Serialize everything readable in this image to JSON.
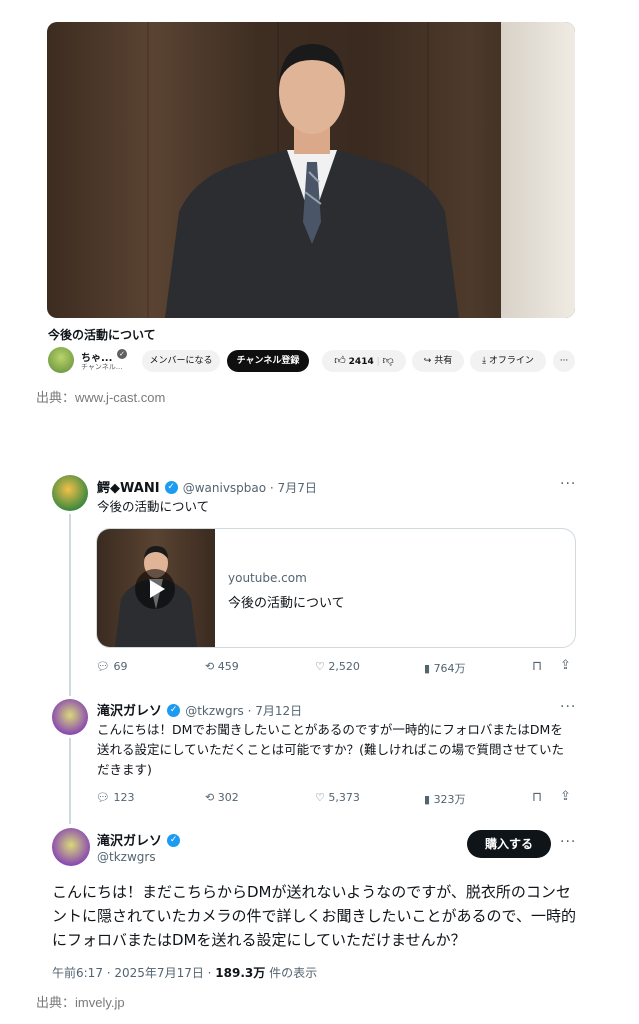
{
  "youtube": {
    "video_title": "今後の活動について",
    "channel_name": "ちゃ...",
    "channel_sub": "チャンネル...",
    "member_btn": "メンバーになる",
    "subscribe_btn": "チャンネル登録",
    "like_count": "2414",
    "share_label": "共有",
    "offline_label": "オフライン",
    "more": "···"
  },
  "caption1": "出典：www.j-cast.com",
  "tweet1": {
    "name": "鰐◆WANI",
    "handle_date": "@wanivspbao · 7月7日",
    "text": "今後の活動について",
    "card_domain": "youtube.com",
    "card_title": "今後の活動について",
    "replies": "69",
    "retweets": "459",
    "likes": "2,520",
    "views": "764万"
  },
  "tweet2": {
    "name": "滝沢ガレソ",
    "handle_date": "@tkzwgrs · 7月12日",
    "text": "こんにちは！DMでお聞きしたいことがあるのですが一時的にフォロバまたはDMを送れる設定にしていただくことは可能ですか？(難しければこの場で質問させていただきます)",
    "replies": "123",
    "retweets": "302",
    "likes": "5,373",
    "views": "323万"
  },
  "tweet3": {
    "name": "滝沢ガレソ",
    "handle": "@tkzwgrs",
    "buy_btn": "購入する",
    "text": "こんにちは！まだこちらからDMが送れないようなのですが、脱衣所のコンセントに隠されていたカメラの件で詳しくお聞きしたいことがあるので、一時的にフォロバまたはDMを送れる設定にしていただけませんか？",
    "timestamp": "午前6:17 · 2025年7月17日 · ",
    "views": "189.3万",
    "views_suffix": " 件の表示"
  },
  "caption2": "出典：imvely.jp",
  "colors": {
    "x_blue": "#1d9bf0",
    "text": "#0f1419",
    "muted": "#536471"
  }
}
